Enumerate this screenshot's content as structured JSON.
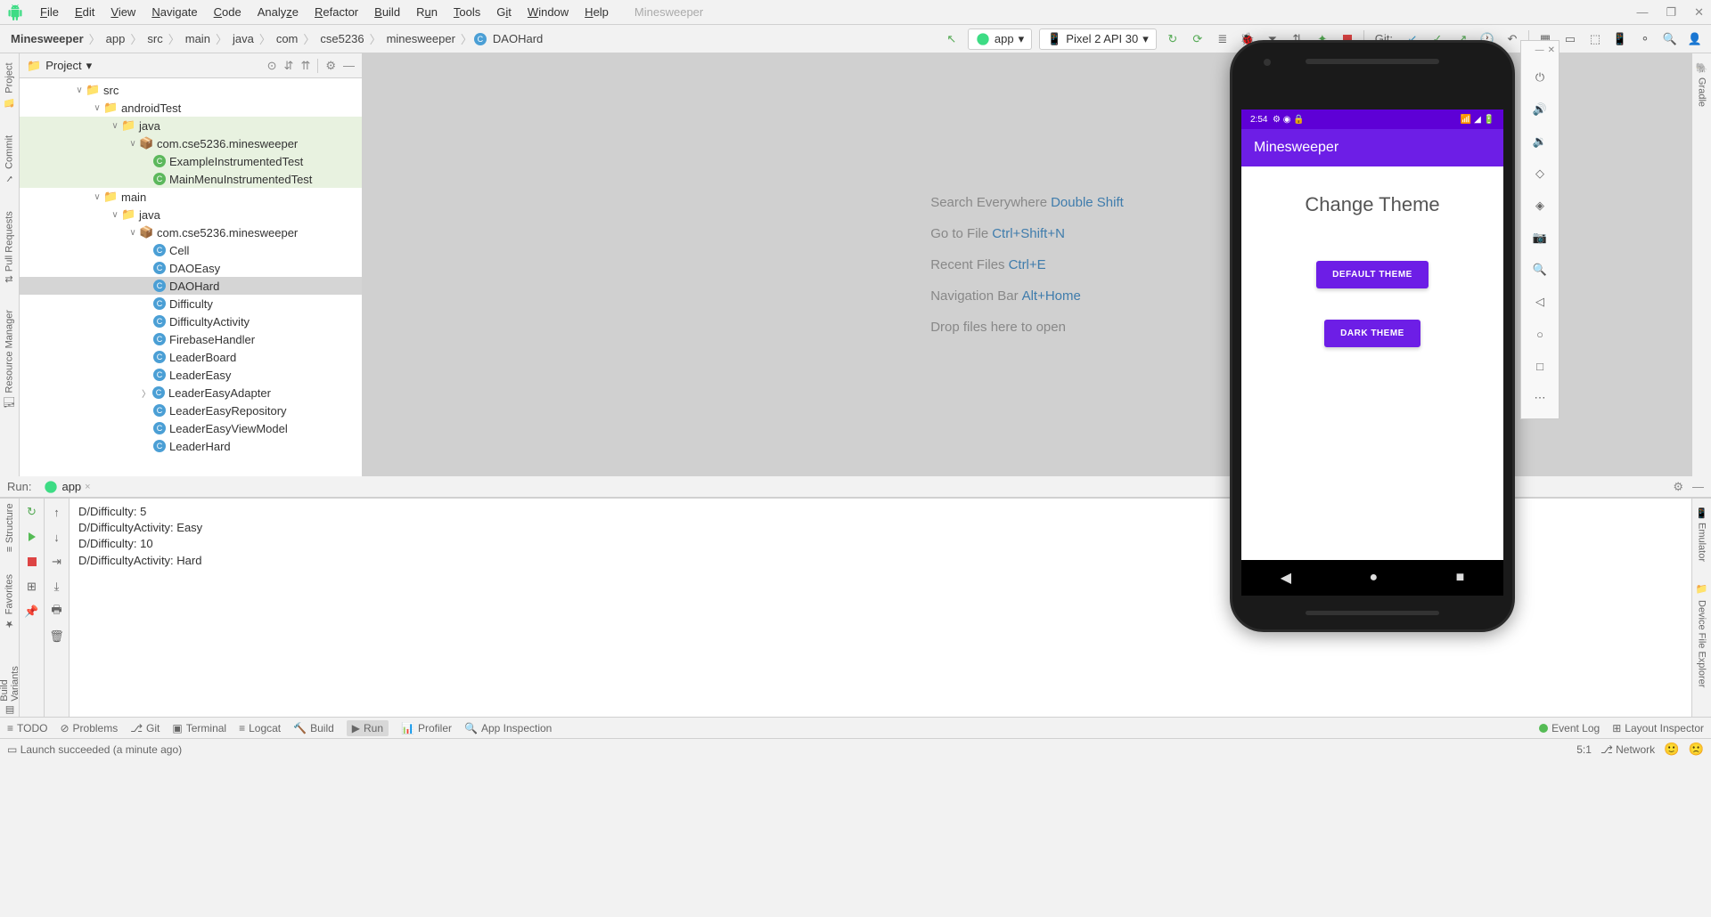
{
  "window": {
    "title": "Minesweeper"
  },
  "menu": [
    "File",
    "Edit",
    "View",
    "Navigate",
    "Code",
    "Analyze",
    "Refactor",
    "Build",
    "Run",
    "Tools",
    "Git",
    "Window",
    "Help"
  ],
  "breadcrumb": [
    "Minesweeper",
    "app",
    "src",
    "main",
    "java",
    "com",
    "cse5236",
    "minesweeper",
    "DAOHard"
  ],
  "toolbar": {
    "run_config": "app",
    "device": "Pixel 2 API 30",
    "git_label": "Git:"
  },
  "left_rail": [
    "Project",
    "Commit",
    "Pull Requests",
    "Resource Manager"
  ],
  "right_rail_top": [
    "Gradle"
  ],
  "right_rail_bottom": [
    "Emulator",
    "Device File Explorer"
  ],
  "project": {
    "header": "Project",
    "tree": {
      "src": "src",
      "androidTest": "androidTest",
      "java1": "java",
      "pkg1": "com.cse5236.minesweeper",
      "test1": "ExampleInstrumentedTest",
      "test2": "MainMenuInstrumentedTest",
      "main": "main",
      "java2": "java",
      "pkg2": "com.cse5236.minesweeper",
      "classes": [
        "Cell",
        "DAOEasy",
        "DAOHard",
        "Difficulty",
        "DifficultyActivity",
        "FirebaseHandler",
        "LeaderBoard",
        "LeaderEasy",
        "LeaderEasyAdapter",
        "LeaderEasyRepository",
        "LeaderEasyViewModel",
        "LeaderHard"
      ]
    }
  },
  "editor_hints": [
    {
      "label": "Search Everywhere ",
      "key": "Double Shift"
    },
    {
      "label": "Go to File ",
      "key": "Ctrl+Shift+N"
    },
    {
      "label": "Recent Files ",
      "key": "Ctrl+E"
    },
    {
      "label": "Navigation Bar ",
      "key": "Alt+Home"
    },
    {
      "label": "Drop files here to open",
      "key": ""
    }
  ],
  "emulator": {
    "time": "2:54",
    "app_title": "Minesweeper",
    "screen_heading": "Change Theme",
    "btn1": "DEFAULT THEME",
    "btn2": "DARK THEME"
  },
  "run": {
    "label": "Run:",
    "tab": "app",
    "output": [
      "D/Difficulty: 5",
      "D/DifficultyActivity: Easy",
      "D/Difficulty: 10",
      "D/DifficultyActivity: Hard"
    ]
  },
  "bottom_tabs": [
    "TODO",
    "Problems",
    "Git",
    "Terminal",
    "Logcat",
    "Build",
    "Run",
    "Profiler",
    "App Inspection"
  ],
  "bottom_right": [
    "Event Log",
    "Layout Inspector"
  ],
  "statusbar": {
    "message": "Launch succeeded (a minute ago)",
    "pos": "5:1",
    "branch": "Network"
  },
  "left_rail_bottom": [
    "Structure",
    "Favorites",
    "Build Variants"
  ]
}
